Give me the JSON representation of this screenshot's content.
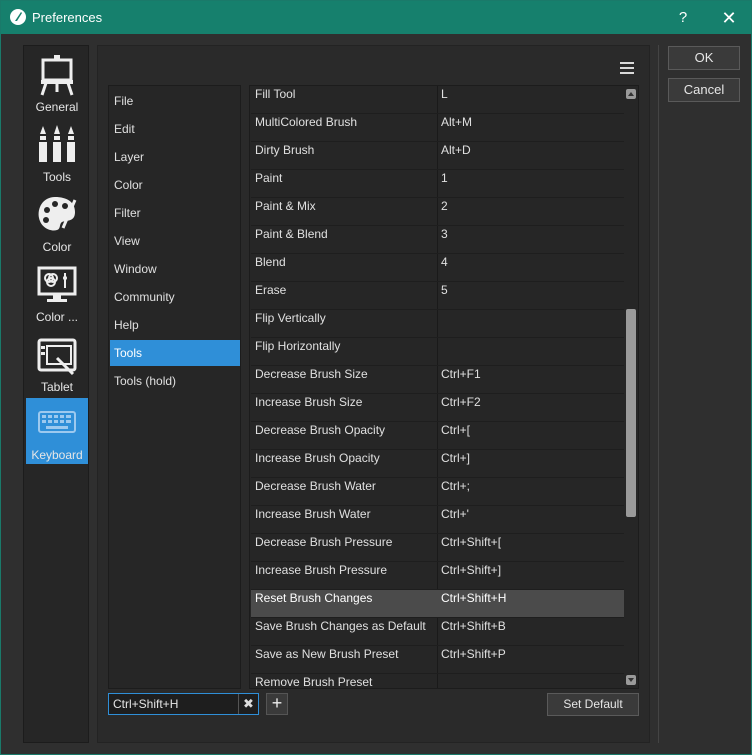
{
  "window": {
    "title": "Preferences",
    "help_label": "?",
    "close_label": "✕"
  },
  "categories": [
    {
      "label": "General",
      "icon": "easel-icon"
    },
    {
      "label": "Tools",
      "icon": "brushes-icon"
    },
    {
      "label": "Color",
      "icon": "palette-icon"
    },
    {
      "label": "Color ...",
      "icon": "color-monitor-icon"
    },
    {
      "label": "Tablet",
      "icon": "tablet-icon"
    },
    {
      "label": "Keyboard",
      "icon": "keyboard-icon",
      "active": true
    }
  ],
  "sections": [
    {
      "label": "File"
    },
    {
      "label": "Edit"
    },
    {
      "label": "Layer"
    },
    {
      "label": "Color"
    },
    {
      "label": "Filter"
    },
    {
      "label": "View"
    },
    {
      "label": "Window"
    },
    {
      "label": "Community"
    },
    {
      "label": "Help"
    },
    {
      "label": "Tools",
      "active": true
    },
    {
      "label": "Tools (hold)"
    }
  ],
  "shortcuts": [
    {
      "action": "Fill Tool",
      "key": "L"
    },
    {
      "action": "MultiColored Brush",
      "key": "Alt+M"
    },
    {
      "action": "Dirty Brush",
      "key": "Alt+D"
    },
    {
      "action": "Paint",
      "key": "1"
    },
    {
      "action": "Paint & Mix",
      "key": "2"
    },
    {
      "action": "Paint & Blend",
      "key": "3"
    },
    {
      "action": "Blend",
      "key": "4"
    },
    {
      "action": "Erase",
      "key": "5"
    },
    {
      "action": "Flip Vertically",
      "key": ""
    },
    {
      "action": "Flip Horizontally",
      "key": ""
    },
    {
      "action": "Decrease Brush Size",
      "key": "Ctrl+F1"
    },
    {
      "action": "Increase Brush Size",
      "key": "Ctrl+F2"
    },
    {
      "action": "Decrease Brush Opacity",
      "key": "Ctrl+["
    },
    {
      "action": "Increase Brush Opacity",
      "key": "Ctrl+]"
    },
    {
      "action": "Decrease Brush Water",
      "key": "Ctrl+;"
    },
    {
      "action": "Increase Brush Water",
      "key": "Ctrl+'"
    },
    {
      "action": "Decrease Brush Pressure",
      "key": "Ctrl+Shift+["
    },
    {
      "action": "Increase Brush Pressure",
      "key": "Ctrl+Shift+]"
    },
    {
      "action": "Reset Brush Changes",
      "key": "Ctrl+Shift+H",
      "selected": true
    },
    {
      "action": "Save Brush Changes as Default",
      "key": "Ctrl+Shift+B"
    },
    {
      "action": "Save as New Brush Preset",
      "key": "Ctrl+Shift+P"
    },
    {
      "action": "Remove Brush Preset",
      "key": ""
    }
  ],
  "editor": {
    "shortcut_value": "Ctrl+Shift+H",
    "clear_label": "✖",
    "add_label": "+",
    "set_default_label": "Set Default"
  },
  "buttons": {
    "ok_label": "OK",
    "cancel_label": "Cancel"
  },
  "colors": {
    "titlebar": "#16806d",
    "accent": "#2f8fd8"
  }
}
